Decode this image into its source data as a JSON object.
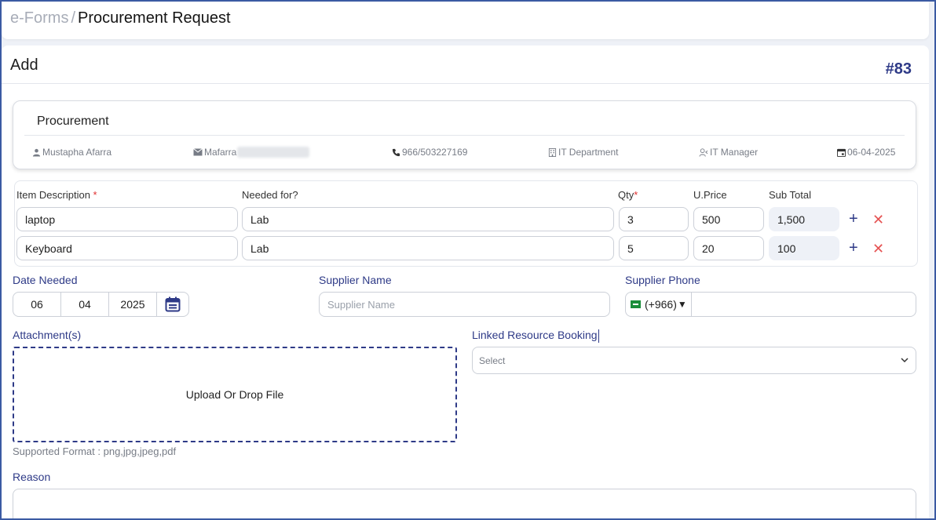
{
  "breadcrumb": {
    "parent": "e-Forms",
    "separator": "/",
    "current": "Procurement Request"
  },
  "card": {
    "title": "Add",
    "form_number": "#83"
  },
  "procurement": {
    "title": "Procurement",
    "user_name": "Mustapha Afarra",
    "email_visible": "Mafarra",
    "phone": "966/503227169",
    "department": "IT Department",
    "role": "IT Manager",
    "date": "06-04-2025"
  },
  "items": {
    "headers": {
      "description": "Item Description",
      "needed_for": "Needed for?",
      "qty": "Qty",
      "unit_price": "U.Price",
      "sub_total": "Sub Total",
      "required_mark": "*"
    },
    "rows": [
      {
        "description": "laptop",
        "needed_for": "Lab",
        "qty": "3",
        "unit_price": "500",
        "sub_total": "1,500"
      },
      {
        "description": "Keyboard",
        "needed_for": "Lab",
        "qty": "5",
        "unit_price": "20",
        "sub_total": "100"
      }
    ],
    "add_symbol": "+",
    "remove_symbol": "✕"
  },
  "date_needed": {
    "label": "Date Needed",
    "day": "06",
    "month": "04",
    "year": "2025"
  },
  "supplier_name": {
    "label": "Supplier Name",
    "placeholder": "Supplier Name"
  },
  "supplier_phone": {
    "label": "Supplier Phone",
    "code": "(+966)",
    "caret": "▼",
    "value": ""
  },
  "attachments": {
    "label": "Attachment(s)",
    "dropzone_text": "Upload Or Drop File",
    "supported": "Supported Format : png,jpg,jpeg,pdf"
  },
  "linked_booking": {
    "label": "Linked Resource Booking",
    "placeholder": "Select"
  },
  "reason": {
    "label": "Reason",
    "value": ""
  },
  "colors": {
    "accent": "#2e3a87",
    "danger": "#e03131",
    "frame": "#3b5aa3"
  },
  "icons": [
    "user-icon",
    "mail-icon",
    "phone-icon",
    "building-icon",
    "user-tie-icon",
    "calendar-icon",
    "plus-icon",
    "close-icon",
    "chevron-down-icon",
    "flag-icon"
  ]
}
